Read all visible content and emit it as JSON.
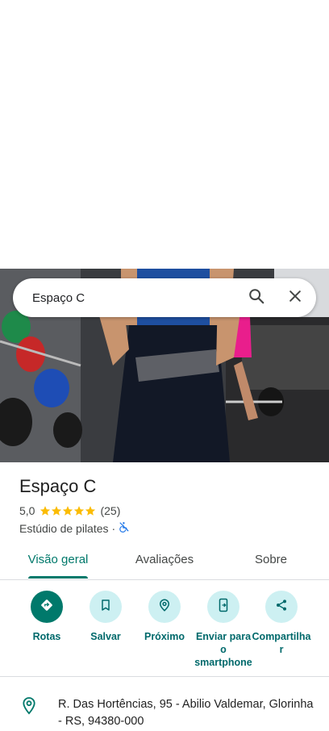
{
  "search": {
    "query": "Espaço C"
  },
  "place": {
    "name": "Espaço C",
    "rating": "5,0",
    "stars_filled": 5,
    "review_count": "(25)",
    "category": "Estúdio de pilates",
    "separator": "·"
  },
  "tabs": [
    {
      "label": "Visão geral",
      "active": true
    },
    {
      "label": "Avaliações",
      "active": false
    },
    {
      "label": "Sobre",
      "active": false
    }
  ],
  "actions": [
    {
      "label": "Rotas",
      "icon": "directions-icon"
    },
    {
      "label": "Salvar",
      "icon": "bookmark-icon"
    },
    {
      "label": "Próximo",
      "icon": "nearby-icon"
    },
    {
      "label": "Enviar para o smartphone",
      "icon": "send-to-phone-icon"
    },
    {
      "label": "Compartilhar",
      "icon": "share-icon"
    }
  ],
  "address": {
    "text": "R. Das Hortências, 95 - Abilio Valdemar, Glorinha - RS, 94380-000"
  },
  "colors": {
    "accent": "#00796b",
    "action_bg": "#cdf0f2",
    "star": "#fbbc04"
  }
}
